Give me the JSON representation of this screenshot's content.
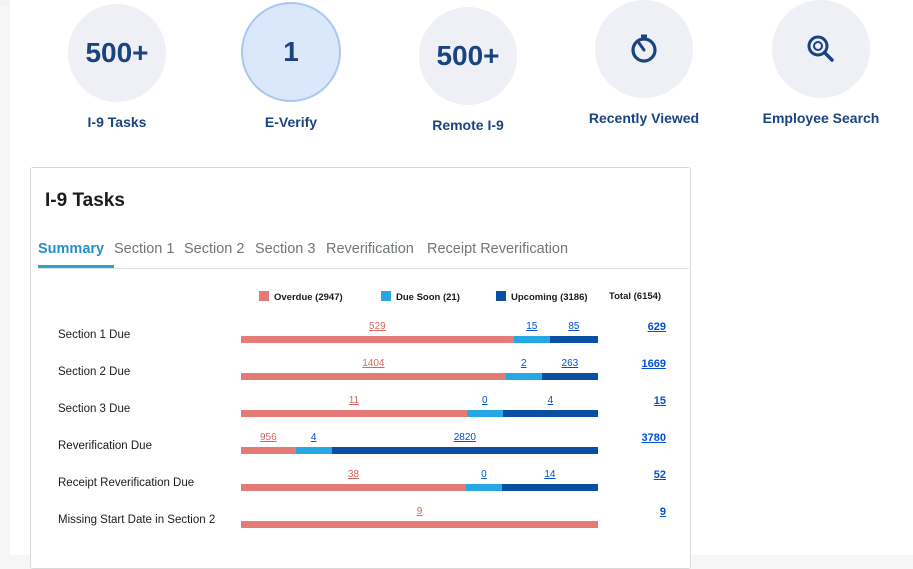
{
  "colors": {
    "overdue": "#e47b77",
    "due_soon": "#27a7e3",
    "upcoming": "#0b4fa3",
    "link": "#0050d8",
    "tile_text": "#1a4480"
  },
  "tiles": [
    {
      "value": "500+",
      "label": "I-9 Tasks",
      "icon": null,
      "active": false
    },
    {
      "value": "1",
      "label": "E-Verify",
      "icon": null,
      "active": true
    },
    {
      "value": "500+",
      "label": "Remote I-9",
      "icon": null,
      "active": false
    },
    {
      "value": null,
      "label": "Recently Viewed",
      "icon": "timer-icon",
      "active": false
    },
    {
      "value": null,
      "label": "Employee Search",
      "icon": "magnify-search-icon",
      "active": false
    }
  ],
  "card": {
    "title": "I-9 Tasks",
    "tabs": [
      "Summary",
      "Section 1",
      "Section 2",
      "Section 3",
      "Reverification",
      "Receipt Reverification"
    ],
    "active_tab": "Summary",
    "legend": {
      "overdue": "Overdue (2947)",
      "due_soon": "Due Soon (21)",
      "upcoming": "Upcoming (3186)",
      "total": "Total (6154)"
    },
    "rows": [
      {
        "label": "Section 1 Due",
        "overdue": "529",
        "due_soon": "15",
        "upcoming": "85",
        "total": "629"
      },
      {
        "label": "Section 2 Due",
        "overdue": "1404",
        "due_soon": "2",
        "upcoming": "263",
        "total": "1669"
      },
      {
        "label": "Section 3 Due",
        "overdue": "11",
        "due_soon": "0",
        "upcoming": "4",
        "total": "15"
      },
      {
        "label": "Reverification Due",
        "overdue": "956",
        "due_soon": "4",
        "upcoming": "2820",
        "total": "3780"
      },
      {
        "label": "Receipt Reverification Due",
        "overdue": "38",
        "due_soon": "0",
        "upcoming": "14",
        "total": "52"
      },
      {
        "label": "Missing Start Date in Section 2",
        "overdue": "9",
        "due_soon": null,
        "upcoming": null,
        "total": "9"
      }
    ]
  }
}
